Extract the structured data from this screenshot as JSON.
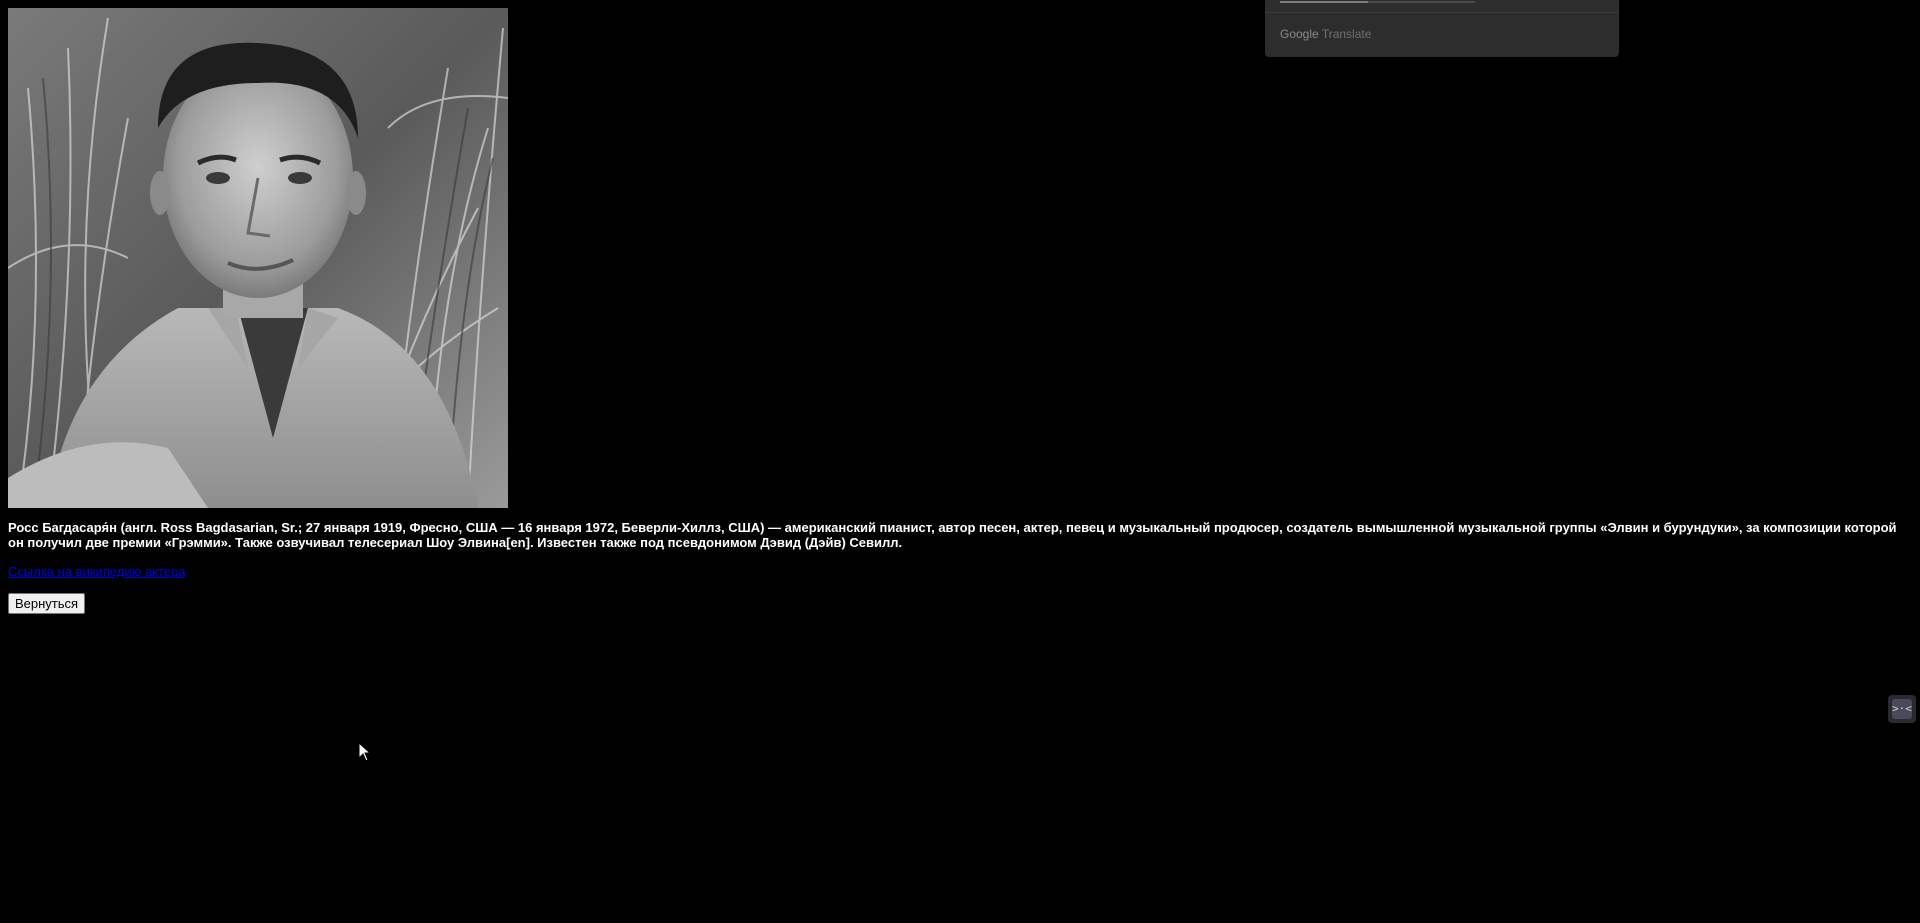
{
  "photo": {
    "alt": "Росс Багдасарян"
  },
  "bio": {
    "text": "Росс Багдасаря́н (англ. Ross Bagdasarian, Sr.; 27 января 1919, Фресно, США — 16 января 1972, Беверли-Хиллз, США) — американский пианист, автор песен, актер, певец и музыкальный продюсер, создатель вымышленной музыкальной группы «Элвин и бурундуки», за композиции которой он получил две премии «Грэмми». Также озвучивал телесериал Шоу Элвина[en]. Известен также под псевдонимом Дэвид (Дэйв) Севилл."
  },
  "wiki_link": {
    "label": "Ссылка на википедию актера"
  },
  "back_button": {
    "label": "Вернуться"
  },
  "google_translate": {
    "brand_google": "Google",
    "brand_translate": "Translate",
    "progress": 0.45
  },
  "extension_widget": {
    "icon": "extension-icon",
    "glyph": ">·<"
  },
  "colors": {
    "background": "#000000",
    "text": "#ffffff",
    "link": "#0000ee",
    "popup": "#2d2d2d"
  }
}
